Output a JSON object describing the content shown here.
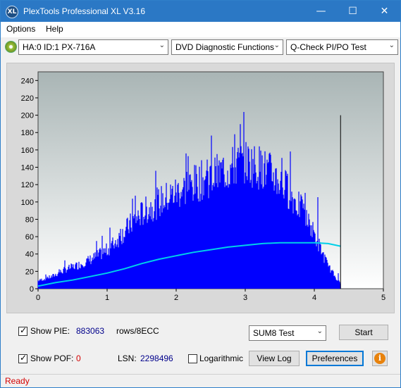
{
  "window": {
    "title": "PlexTools Professional XL V3.16",
    "app_icon_text": "XL",
    "minimize_glyph": "—",
    "maximize_glyph": "☐",
    "close_glyph": "✕"
  },
  "menu": {
    "options": "Options",
    "help": "Help"
  },
  "toolbar": {
    "drive": "HA:0 ID:1  PX-716A",
    "function": "DVD Diagnostic Functions",
    "test": "Q-Check PI/PO Test",
    "dropdown_glyph": "⌄"
  },
  "chart_data": {
    "type": "area",
    "x_ticks": [
      "0",
      "1",
      "2",
      "3",
      "4",
      "5"
    ],
    "y_ticks": [
      "0",
      "20",
      "40",
      "60",
      "80",
      "100",
      "120",
      "140",
      "160",
      "180",
      "200",
      "220",
      "240"
    ],
    "xlim": [
      0,
      5
    ],
    "ylim": [
      0,
      250
    ],
    "grid": false,
    "marker_x": 4.38,
    "series": [
      {
        "kind": "bars",
        "color": "#0000ff",
        "x": [
          0.0,
          0.2,
          0.4,
          0.6,
          0.8,
          1.0,
          1.2,
          1.4,
          1.6,
          1.8,
          2.0,
          2.2,
          2.4,
          2.6,
          2.8,
          3.0,
          3.2,
          3.4,
          3.6,
          3.8,
          4.0,
          4.2,
          4.38
        ],
        "y": [
          10,
          15,
          24,
          30,
          38,
          48,
          66,
          86,
          100,
          110,
          120,
          128,
          136,
          142,
          150,
          158,
          152,
          142,
          125,
          100,
          68,
          28,
          6
        ],
        "peaks": [
          12,
          20,
          35,
          40,
          55,
          85,
          100,
          120,
          130,
          150,
          160,
          165,
          170,
          190,
          200,
          205,
          200,
          190,
          175,
          160,
          130,
          60,
          25
        ]
      },
      {
        "kind": "line",
        "color": "#00d0e8",
        "x": [
          0.0,
          0.25,
          0.5,
          0.75,
          1.0,
          1.25,
          1.5,
          1.75,
          2.0,
          2.25,
          2.5,
          2.75,
          3.0,
          3.25,
          3.5,
          3.75,
          4.0,
          4.2,
          4.38
        ],
        "y": [
          3,
          7,
          10,
          14,
          18,
          23,
          29,
          34,
          38,
          42,
          45,
          48,
          50,
          52,
          53,
          53,
          53,
          52,
          49
        ]
      }
    ]
  },
  "controls": {
    "show_pie_label": "Show PIE:",
    "show_pie_checked": true,
    "pie_value": "883063",
    "pie_unit": "rows/8ECC",
    "show_pof_label": "Show POF:",
    "show_pof_checked": true,
    "pof_value": "0",
    "lsn_label": "LSN:",
    "lsn_value": "2298496",
    "logarithmic_label": "Logarithmic",
    "logarithmic_checked": false,
    "test_mode": "SUM8 Test",
    "start_label": "Start",
    "view_log_label": "View Log",
    "preferences_label": "Preferences",
    "info_icon": "i",
    "check_glyph": "✓"
  },
  "status": {
    "text": "Ready"
  },
  "colors": {
    "titlebar": "#2b78c5",
    "plot_bg_top": "#a9b5b5",
    "plot_bg_bottom": "#ffffff",
    "bars": "#0000ff",
    "avg_line": "#00d0e8",
    "status_text": "#d40000"
  }
}
